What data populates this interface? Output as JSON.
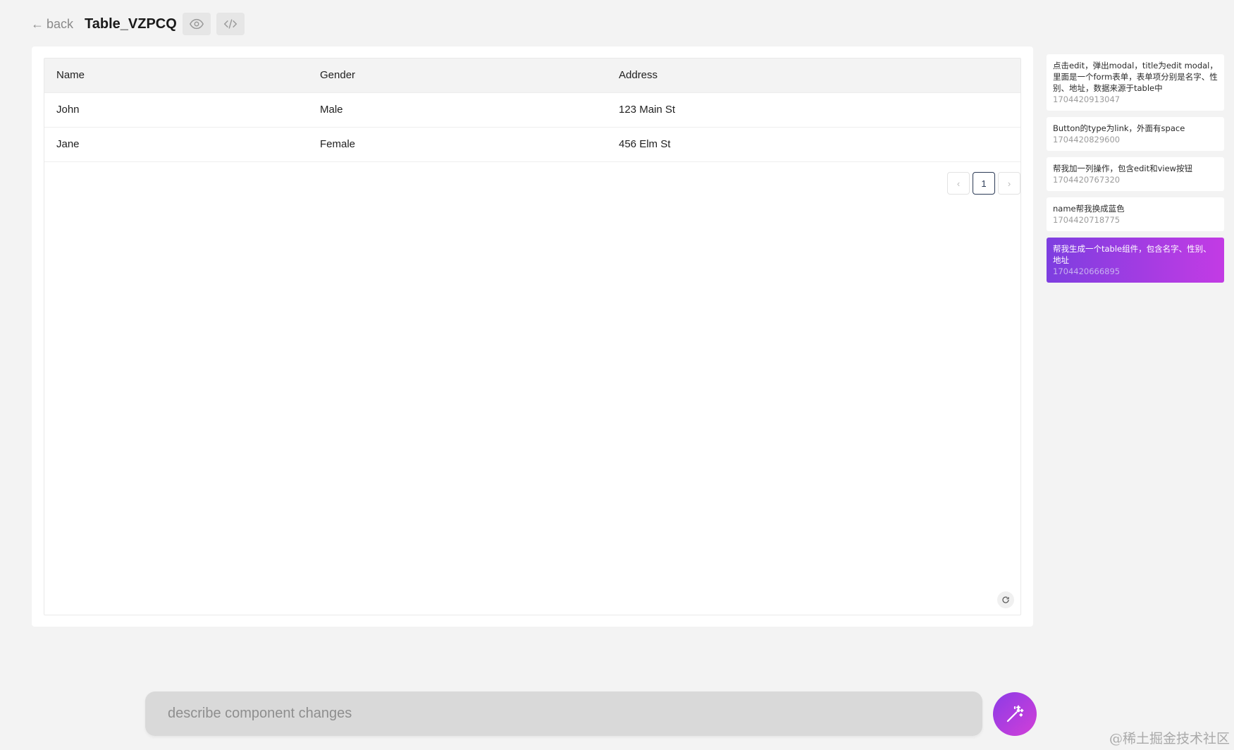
{
  "header": {
    "back_label": "back",
    "title": "Table_VZPCQ",
    "preview_icon": "eye-icon",
    "code_icon": "code-icon"
  },
  "table": {
    "columns": [
      "Name",
      "Gender",
      "Address"
    ],
    "rows": [
      [
        "John",
        "Male",
        "123 Main St"
      ],
      [
        "Jane",
        "Female",
        "456 Elm St"
      ]
    ],
    "pagination": {
      "prev": "‹",
      "current": "1",
      "next": "›"
    }
  },
  "history": [
    {
      "text": "点击edit，弹出modal，title为edit modal，里面是一个form表单，表单项分别是名字、性别、地址，数据来源于table中",
      "timestamp": "1704420913047"
    },
    {
      "text": "Button的type为link，外面有space",
      "timestamp": "1704420829600"
    },
    {
      "text": "帮我加一列操作，包含edit和view按钮",
      "timestamp": "1704420767320"
    },
    {
      "text": "name帮我换成蓝色",
      "timestamp": "1704420718775"
    },
    {
      "text": "帮我生成一个table组件，包含名字、性别、地址",
      "timestamp": "1704420666895",
      "active": true
    }
  ],
  "prompt": {
    "placeholder": "describe component changes",
    "value": ""
  },
  "watermark": "@稀土掘金技术社区",
  "colors": {
    "accent_start": "#7d3ee0",
    "accent_end": "#c33be4",
    "pager_active": "#2b3a55"
  }
}
